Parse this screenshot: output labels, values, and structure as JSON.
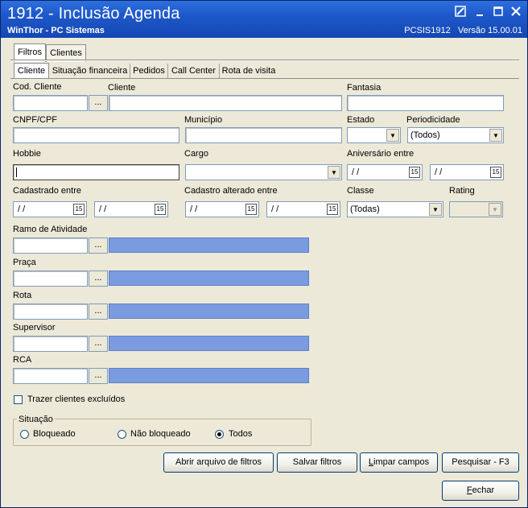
{
  "window": {
    "title": "1912 - Inclusão Agenda",
    "subtitle": "WinThor - PC Sistemas",
    "routine": "PCSIS1912",
    "version": "Versão 15.00.01"
  },
  "tabs": [
    "Filtros",
    "Clientes"
  ],
  "subtabs": [
    "Cliente",
    "Situação financeira",
    "Pedidos",
    "Call Center",
    "Rota de visita"
  ],
  "fields": {
    "cod_cliente": "Cod. Cliente",
    "cliente": "Cliente",
    "fantasia": "Fantasia",
    "cnpf_cpf": "CNPF/CPF",
    "municipio": "Município",
    "estado": "Estado",
    "periodicidade": "Periodicidade",
    "periodicidade_value": "(Todos)",
    "hobbie": "Hobbie",
    "cargo": "Cargo",
    "aniversario": "Aniversário entre",
    "cadastrado": "Cadastrado entre",
    "cadastro_alterado": "Cadastro alterado entre",
    "classe": "Classe",
    "classe_value": "(Todas)",
    "rating": "Rating",
    "ramo": "Ramo de Atividade",
    "praca": "Praça",
    "rota": "Rota",
    "supervisor": "Supervisor",
    "rca": "RCA",
    "date_placeholder": "/ /",
    "ellipsis": "...",
    "cal_icon_text": "15"
  },
  "options": {
    "trazer_excluidos": "Trazer clientes excluídos",
    "situacao_title": "Situação",
    "bloqueado": "Bloqueado",
    "nao_bloqueado": "Não bloqueado",
    "todos": "Todos",
    "selected_situacao": "Todos"
  },
  "buttons": {
    "abrir": "Abrir arquivo de filtros",
    "salvar": "Salvar filtros",
    "limpar_pre": "L",
    "limpar_rest": "impar campos",
    "pesquisar": "Pesquisar - F3",
    "fechar_pre": "F",
    "fechar_rest": "echar"
  },
  "colors": {
    "titlebar": "#1e58c8",
    "lookup_bar": "#7b9be0",
    "window_bg": "#ece9d8"
  }
}
